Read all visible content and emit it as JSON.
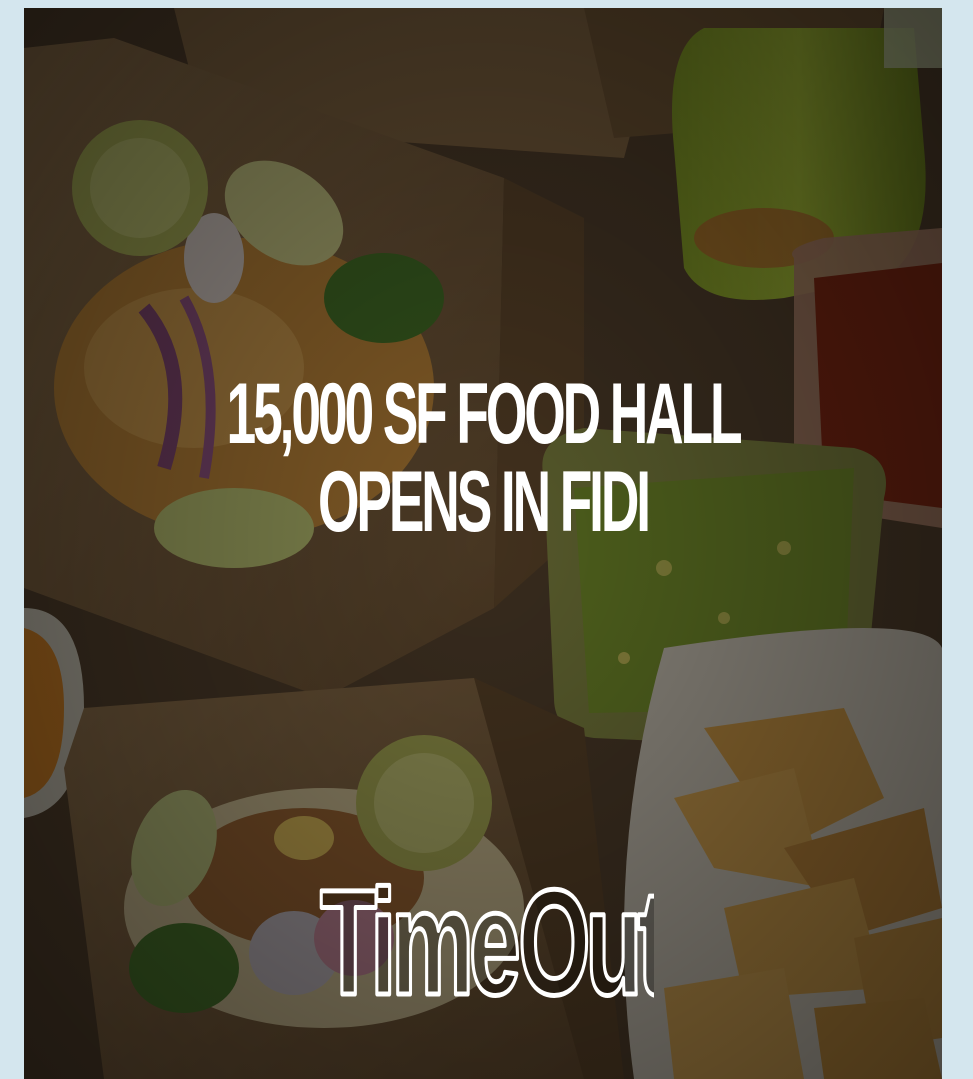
{
  "headline": {
    "line1": "15,000 SF FOOD HALL",
    "line2": "OPENS IN FIDI"
  },
  "logo": {
    "brand": "Time Out",
    "part1": "Time",
    "part2": "Out"
  },
  "colors": {
    "page_background": "#d4e6ee",
    "text": "#ffffff",
    "cardboard": "#8a6a45"
  },
  "icons": [
    "time-out-logo-icon"
  ]
}
